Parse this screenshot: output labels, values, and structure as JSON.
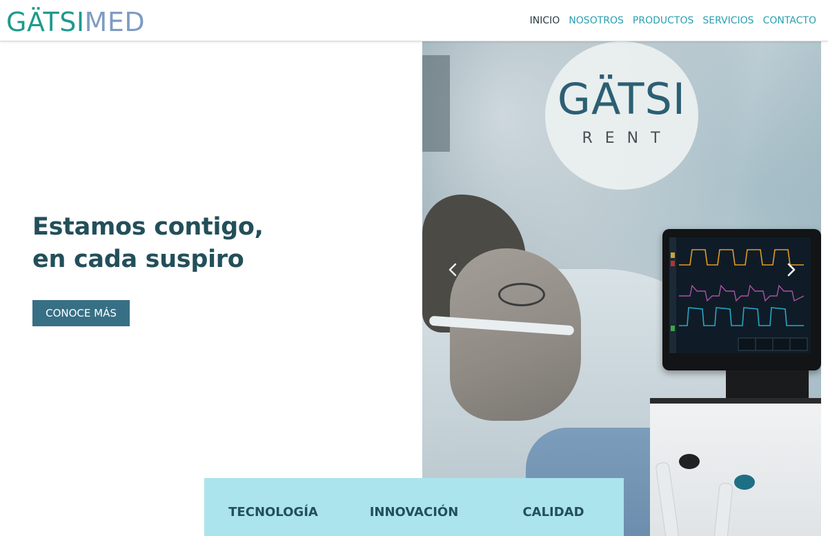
{
  "brand": {
    "logo_part1": "GÄTSI",
    "logo_part2": "MED"
  },
  "nav": {
    "items": [
      {
        "label": "INICIO",
        "active": true
      },
      {
        "label": "NOSOTROS",
        "active": false
      },
      {
        "label": "PRODUCTOS",
        "active": false
      },
      {
        "label": "SERVICIOS",
        "active": false
      },
      {
        "label": "CONTACTO",
        "active": false
      }
    ]
  },
  "hero": {
    "title_line1": "Estamos contigo,",
    "title_line2": "en cada suspiro",
    "cta_label": "CONOCE MÁS"
  },
  "slider": {
    "badge_line1": "GÄTSI",
    "badge_line2": "RENT",
    "prev_icon": "chevron-left-icon",
    "next_icon": "chevron-right-icon"
  },
  "features": [
    "TECNOLOGÍA",
    "INNOVACIÓN",
    "CALIDAD"
  ],
  "colors": {
    "logo_teal": "#1f9a8f",
    "logo_blue": "#7f9bc4",
    "nav_link": "#2a9fb0",
    "nav_active": "#2b3b44",
    "heading": "#234f5a",
    "cta_bg": "#376f85",
    "features_bg": "#abe4ec"
  }
}
